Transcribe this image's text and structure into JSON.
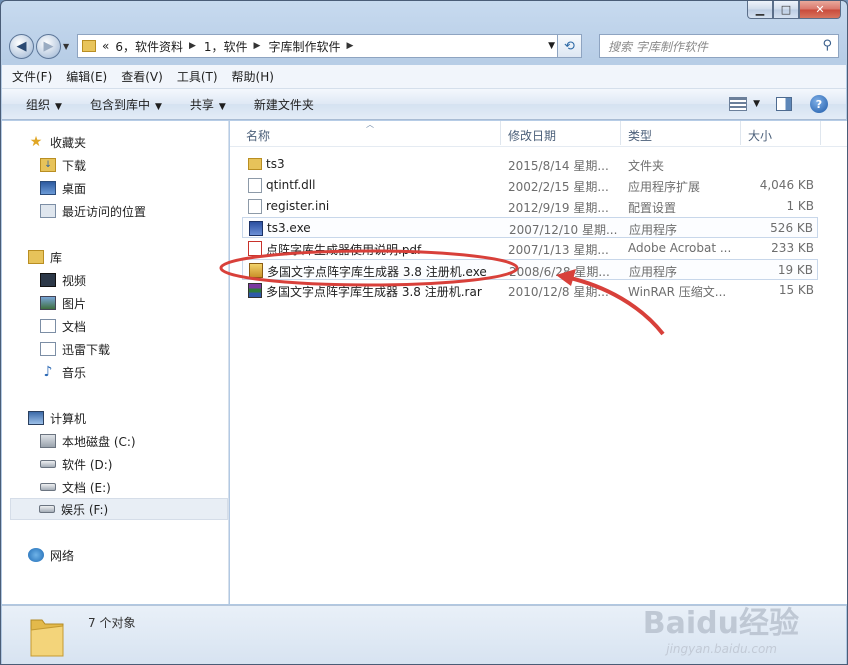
{
  "address": {
    "crumbs": [
      "«",
      "6，软件资料",
      "1，软件",
      "字库制作软件"
    ]
  },
  "search": {
    "placeholder": "搜索 字库制作软件"
  },
  "menu": [
    "文件(F)",
    "编辑(E)",
    "查看(V)",
    "工具(T)",
    "帮助(H)"
  ],
  "commands": [
    "组织",
    "包含到库中",
    "共享",
    "新建文件夹"
  ],
  "nav": {
    "favorites": {
      "label": "收藏夹",
      "items": [
        "下载",
        "桌面",
        "最近访问的位置"
      ]
    },
    "libraries": {
      "label": "库",
      "items": [
        "视频",
        "图片",
        "文档",
        "迅雷下载",
        "音乐"
      ]
    },
    "computer": {
      "label": "计算机",
      "items": [
        "本地磁盘 (C:)",
        "软件 (D:)",
        "文档 (E:)",
        "娱乐 (F:)"
      ]
    },
    "network": {
      "label": "网络"
    }
  },
  "columns": {
    "name": "名称",
    "date": "修改日期",
    "type": "类型",
    "size": "大小"
  },
  "files": [
    {
      "name": "ts3",
      "date": "2015/8/14 星期...",
      "type": "文件夹",
      "size": "",
      "icon": "folder-icon"
    },
    {
      "name": "qtintf.dll",
      "date": "2002/2/15 星期...",
      "type": "应用程序扩展",
      "size": "4,046 KB",
      "icon": "dll-icon"
    },
    {
      "name": "register.ini",
      "date": "2012/9/19 星期...",
      "type": "配置设置",
      "size": "1 KB",
      "icon": "ini-icon"
    },
    {
      "name": "ts3.exe",
      "date": "2007/12/10 星期...",
      "type": "应用程序",
      "size": "526 KB",
      "icon": "exe-icon"
    },
    {
      "name": "点阵字库生成器使用说明.pdf",
      "date": "2007/1/13 星期...",
      "type": "Adobe Acrobat ...",
      "size": "233 KB",
      "icon": "pdf-icon"
    },
    {
      "name": "多国文字点阵字库生成器 3.8 注册机.exe",
      "date": "2008/6/28 星期...",
      "type": "应用程序",
      "size": "19 KB",
      "icon": "keygen-icon"
    },
    {
      "name": "多国文字点阵字库生成器 3.8 注册机.rar",
      "date": "2010/12/8 星期...",
      "type": "WinRAR 压缩文...",
      "size": "15 KB",
      "icon": "rar-icon"
    }
  ],
  "status": {
    "count": "7 个对象"
  },
  "watermark": {
    "brand": "Baidu经验",
    "url": "jingyan.baidu.com"
  },
  "colors": {
    "annotation": "#d8403a",
    "selection": "#e8eef5"
  }
}
